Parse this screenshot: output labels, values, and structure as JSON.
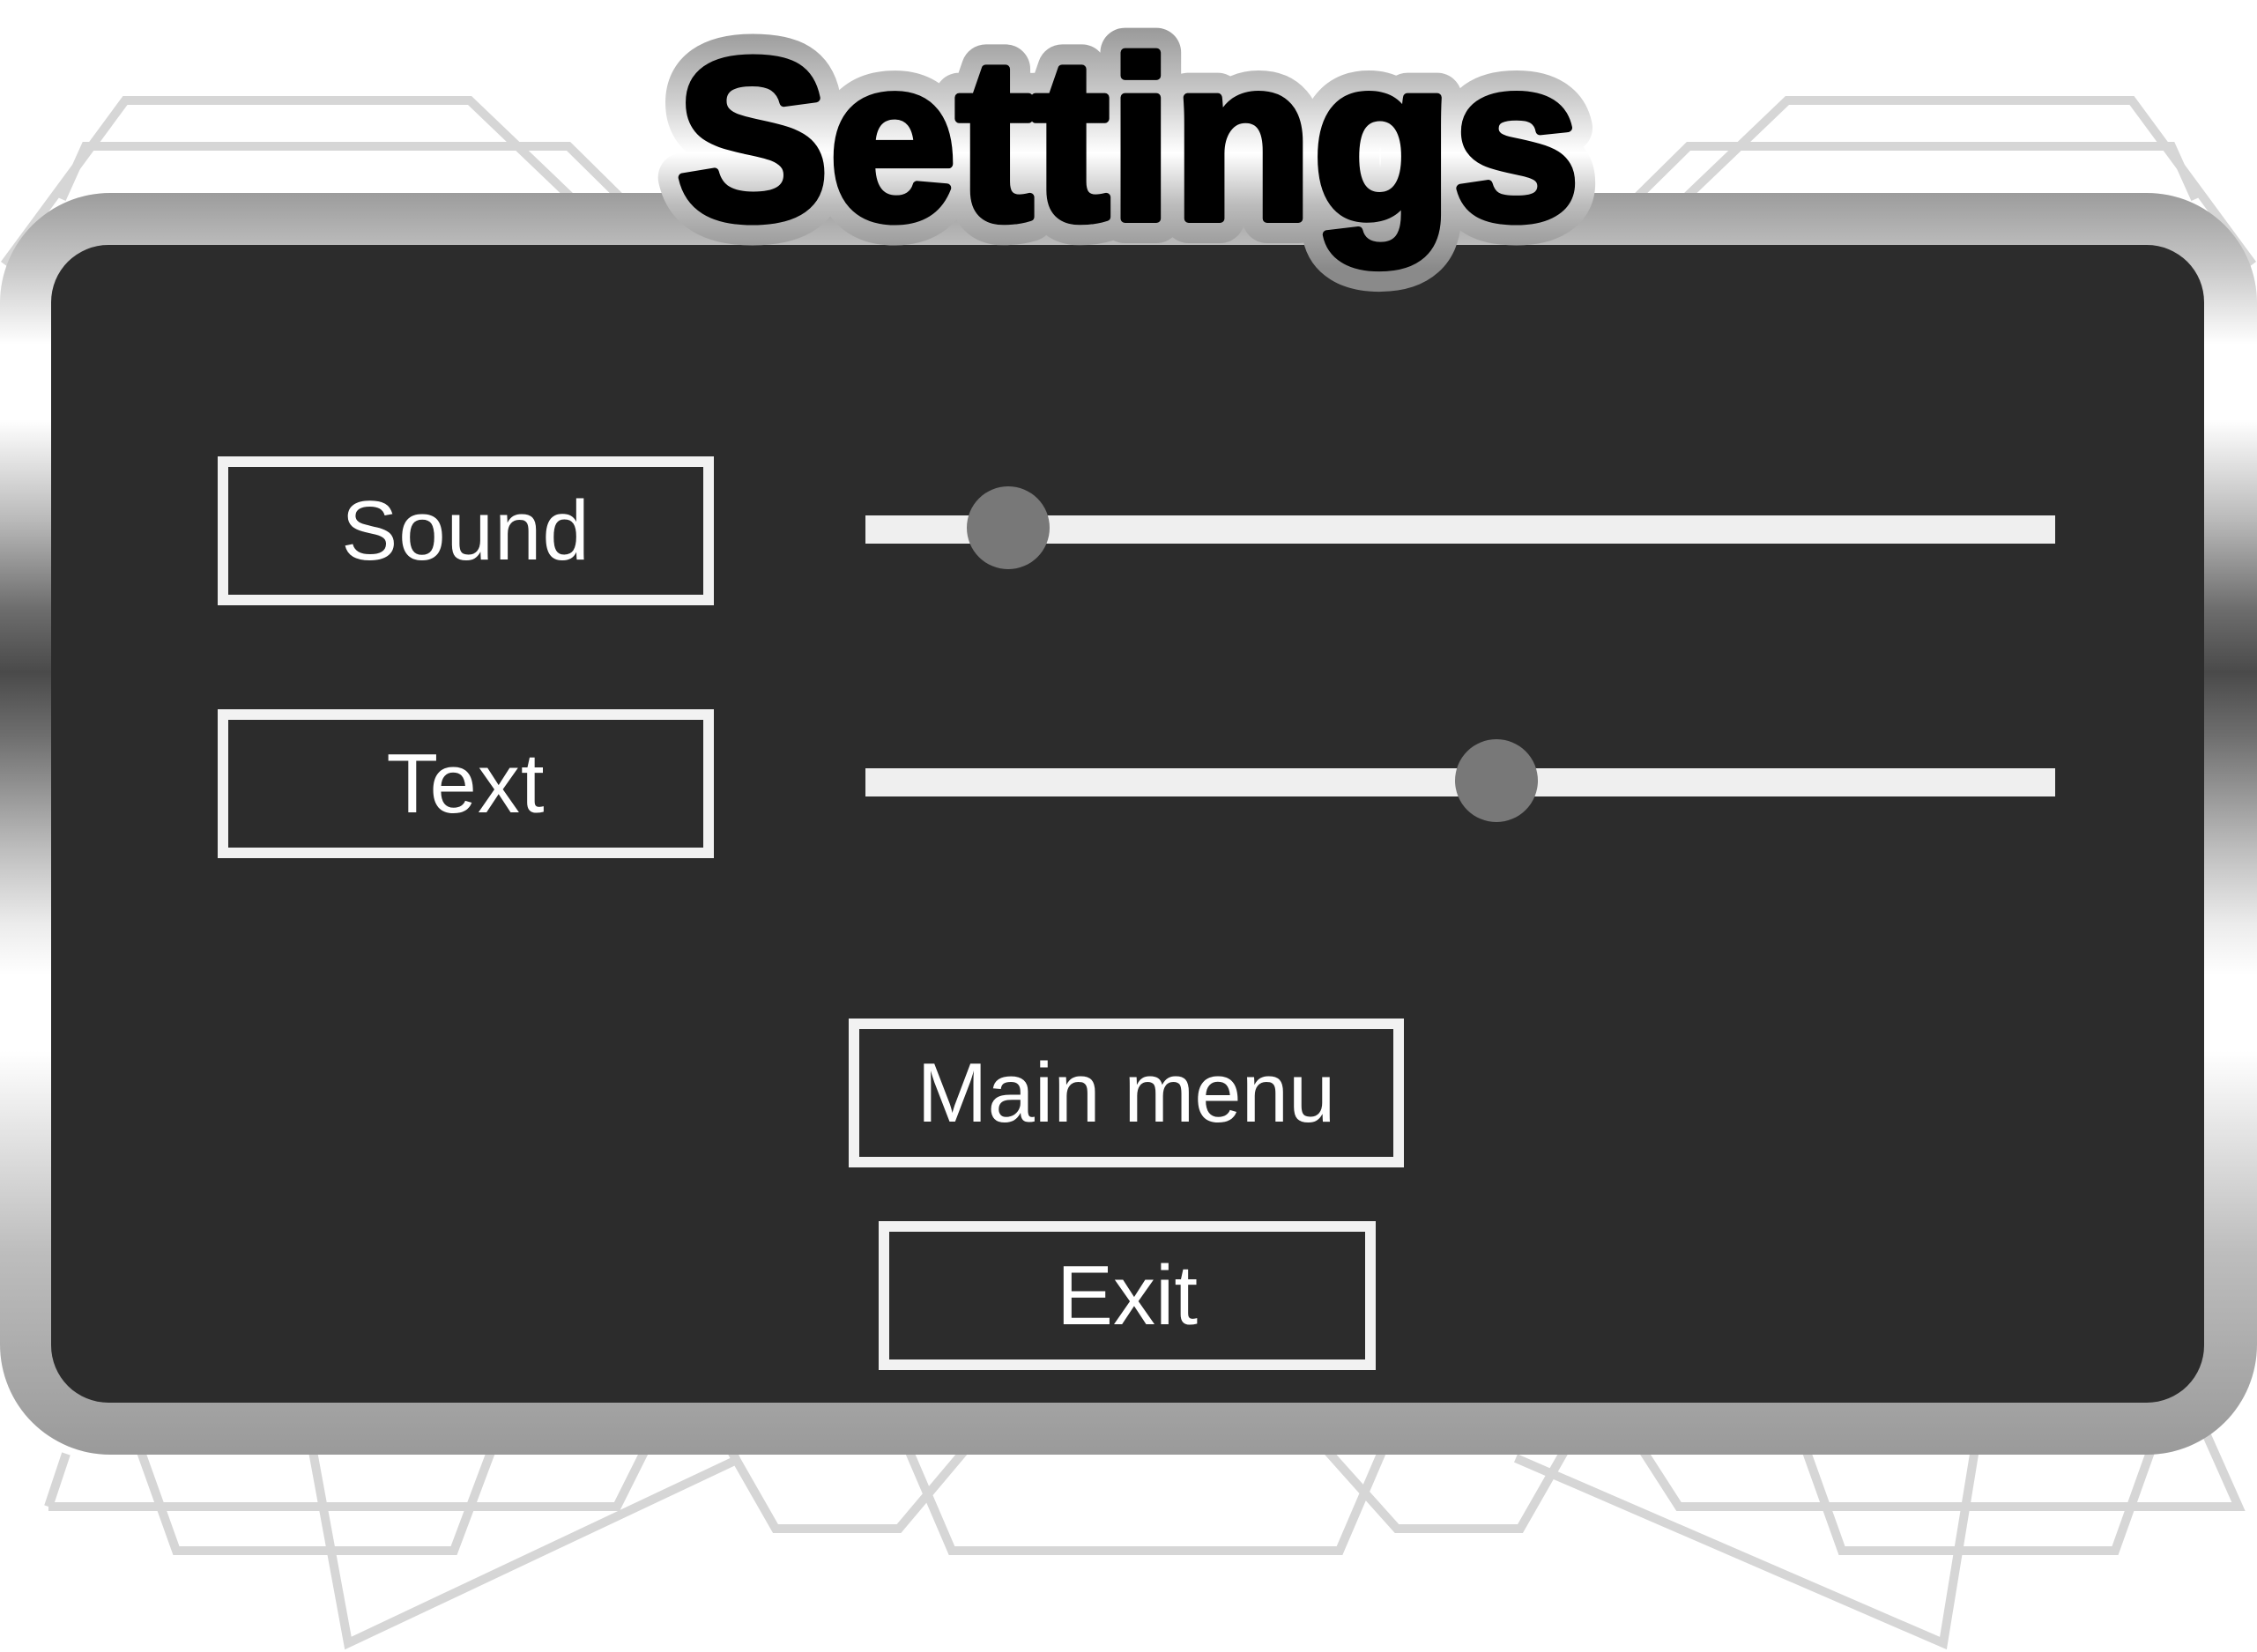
{
  "title": "Settings",
  "settings": [
    {
      "label": "Sound",
      "value_percent": 12
    },
    {
      "label": "Text",
      "value_percent": 53
    }
  ],
  "buttons": {
    "main_menu": "Main menu",
    "exit": "Exit"
  },
  "colors": {
    "panel": "#2c2c2c",
    "outline": "#f2f2f2",
    "track": "#efefef",
    "knob": "#787878",
    "background_lines": "#d6d6d6"
  }
}
